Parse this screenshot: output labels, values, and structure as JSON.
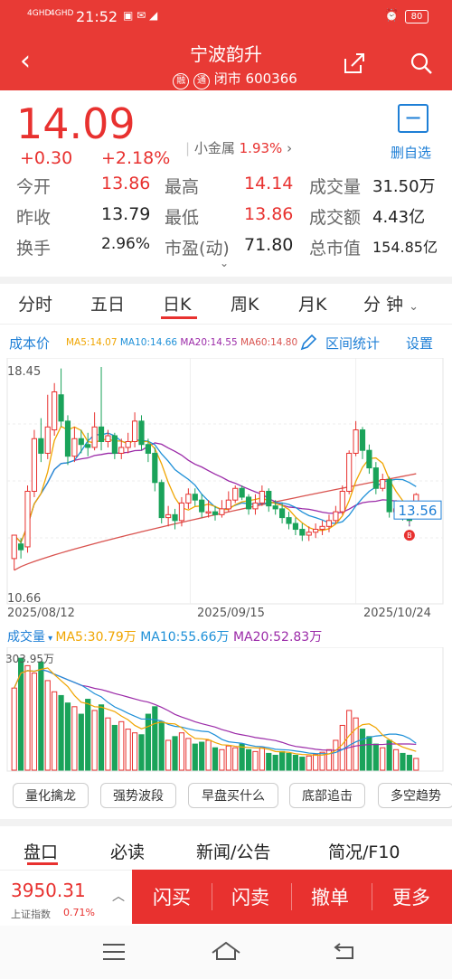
{
  "status": {
    "signal1": "4GHD",
    "signal2": "4GHD",
    "time": "21:52",
    "battery": "80"
  },
  "header": {
    "title": "宁波韵升",
    "badge1": "融",
    "badge2": "通",
    "subtitle": "闭市 600366"
  },
  "quote": {
    "price": "14.09",
    "change": "+0.30",
    "change_pct": "+2.18%",
    "sector": "小金属",
    "sector_pct": "1.93%",
    "watch_label": "删自选",
    "rows": [
      [
        {
          "k": "今开",
          "v": "13.86"
        },
        {
          "k": "最高",
          "v": "14.14"
        },
        {
          "k": "成交量",
          "v": "31.50万"
        }
      ],
      [
        {
          "k": "昨收",
          "v": "13.79"
        },
        {
          "k": "最低",
          "v": "13.86"
        },
        {
          "k": "成交额",
          "v": "4.43亿"
        }
      ],
      [
        {
          "k": "换手",
          "v": "2.96%"
        },
        {
          "k": "市盈(动)",
          "v": "71.80"
        },
        {
          "k": "总市值",
          "v": "154.85亿"
        }
      ]
    ]
  },
  "tabs": [
    "分时",
    "五日",
    "日K",
    "周K",
    "月K",
    "分 钟"
  ],
  "chart_tools": {
    "cost": "成本价",
    "range": "区间统计",
    "settings": "设置"
  },
  "ma_legend": {
    "ma5": "MA5:14.07",
    "ma10": "MA10:14.66",
    "ma20": "MA20:14.55",
    "ma60": "MA60:14.80"
  },
  "vol_legend": {
    "label": "成交量",
    "ma5": "MA5:30.79万",
    "ma10": "MA10:55.66万",
    "ma20": "MA20:52.83万",
    "max": "303.95万"
  },
  "price_axis": {
    "high": "18.45",
    "low": "10.66",
    "last": "13.56",
    "marker": "B"
  },
  "dates": [
    "2025/08/12",
    "2025/09/15",
    "2025/10/24"
  ],
  "colors": {
    "up": "#e8312f",
    "down": "#1aa35a",
    "ma5": "#f0a500",
    "ma10": "#1e90d8",
    "ma20": "#9b2aa8",
    "ma60": "#d9534f"
  },
  "pills": [
    "量化擒龙",
    "强势波段",
    "早盘买什么",
    "底部追击",
    "多空趋势"
  ],
  "bottom_tabs": [
    "盘口",
    "必读",
    "新闻/公告",
    "简况/F10"
  ],
  "index": {
    "value": "3950.31",
    "name": "上证指数",
    "pct": "0.71%"
  },
  "actions": [
    "闪买",
    "闪卖",
    "撤单",
    "更多"
  ],
  "chart_data": {
    "type": "candlestick",
    "candles": [
      [
        11.9,
        12.7,
        11.5,
        12.4
      ],
      [
        12.4,
        12.2,
        11.9,
        12.6
      ],
      [
        12.3,
        14.2,
        12.1,
        14.4
      ],
      [
        14.2,
        16.0,
        14.0,
        16.3
      ],
      [
        16.0,
        15.5,
        15.2,
        16.7
      ],
      [
        15.5,
        16.4,
        15.3,
        17.5
      ],
      [
        16.3,
        17.6,
        16.1,
        17.9
      ],
      [
        17.5,
        16.6,
        16.4,
        18.4
      ],
      [
        16.6,
        15.4,
        15.1,
        16.8
      ],
      [
        15.4,
        16.0,
        15.2,
        16.4
      ],
      [
        16.0,
        15.8,
        15.5,
        16.3
      ],
      [
        15.8,
        15.7,
        15.4,
        16.2
      ],
      [
        15.7,
        16.4,
        15.6,
        16.9
      ],
      [
        16.4,
        15.9,
        15.6,
        18.45
      ],
      [
        15.9,
        16.1,
        15.7,
        16.3
      ],
      [
        16.1,
        15.5,
        15.3,
        16.2
      ],
      [
        15.5,
        15.7,
        15.3,
        16.0
      ],
      [
        15.7,
        15.9,
        15.5,
        16.2
      ],
      [
        15.9,
        16.6,
        15.7,
        16.9
      ],
      [
        16.6,
        15.8,
        15.6,
        16.8
      ],
      [
        15.8,
        15.5,
        15.2,
        16.0
      ],
      [
        15.5,
        14.5,
        14.2,
        15.7
      ],
      [
        14.5,
        13.3,
        13.1,
        14.6
      ],
      [
        13.3,
        13.4,
        13.0,
        13.7
      ],
      [
        13.4,
        13.2,
        12.9,
        13.6
      ],
      [
        13.2,
        13.8,
        13.0,
        14.0
      ],
      [
        13.8,
        14.1,
        13.6,
        14.3
      ],
      [
        14.1,
        13.9,
        13.7,
        14.3
      ],
      [
        13.9,
        13.5,
        13.3,
        14.1
      ],
      [
        13.5,
        13.5,
        13.3,
        13.9
      ],
      [
        13.5,
        13.4,
        13.2,
        13.7
      ],
      [
        13.4,
        13.6,
        13.3,
        13.9
      ],
      [
        13.6,
        13.9,
        13.5,
        14.2
      ],
      [
        13.9,
        14.3,
        13.8,
        14.4
      ],
      [
        14.3,
        14.0,
        13.9,
        14.4
      ],
      [
        14.0,
        13.6,
        13.4,
        14.1
      ],
      [
        13.6,
        13.8,
        13.4,
        14.1
      ],
      [
        13.8,
        14.2,
        13.7,
        14.4
      ],
      [
        14.2,
        13.7,
        13.5,
        14.3
      ],
      [
        13.7,
        13.6,
        13.4,
        13.9
      ],
      [
        13.6,
        13.3,
        13.1,
        13.8
      ],
      [
        13.3,
        13.1,
        12.9,
        13.5
      ],
      [
        13.1,
        12.9,
        12.7,
        13.3
      ],
      [
        12.9,
        12.7,
        12.5,
        13.1
      ],
      [
        12.7,
        12.8,
        12.5,
        13.0
      ],
      [
        12.8,
        12.9,
        12.6,
        13.1
      ],
      [
        12.9,
        13.0,
        12.7,
        13.2
      ],
      [
        13.0,
        13.2,
        12.8,
        13.4
      ],
      [
        13.2,
        13.5,
        13.1,
        13.7
      ],
      [
        13.5,
        14.2,
        13.4,
        14.4
      ],
      [
        14.2,
        15.5,
        14.1,
        15.6
      ],
      [
        15.5,
        16.3,
        15.4,
        16.6
      ],
      [
        16.3,
        15.6,
        15.3,
        16.4
      ],
      [
        15.6,
        15.0,
        14.8,
        15.8
      ],
      [
        15.0,
        14.3,
        14.1,
        15.2
      ],
      [
        14.3,
        14.6,
        14.2,
        14.8
      ],
      [
        14.6,
        13.5,
        13.3,
        14.7
      ],
      [
        13.5,
        13.6,
        13.3,
        13.9
      ],
      [
        13.6,
        13.4,
        13.2,
        13.8
      ],
      [
        13.4,
        13.2,
        13.0,
        13.6
      ],
      [
        13.79,
        14.09,
        13.86,
        14.14
      ]
    ],
    "volume": [
      220,
      300,
      280,
      260,
      290,
      240,
      210,
      200,
      180,
      170,
      150,
      190,
      160,
      175,
      140,
      120,
      130,
      110,
      100,
      95,
      150,
      170,
      130,
      80,
      90,
      100,
      85,
      70,
      75,
      80,
      60,
      55,
      65,
      60,
      70,
      55,
      50,
      60,
      45,
      40,
      50,
      45,
      40,
      35,
      38,
      42,
      48,
      55,
      80,
      120,
      160,
      140,
      110,
      90,
      70,
      60,
      80,
      55,
      45,
      40,
      31.5
    ],
    "ylim": [
      10.66,
      18.45
    ]
  }
}
